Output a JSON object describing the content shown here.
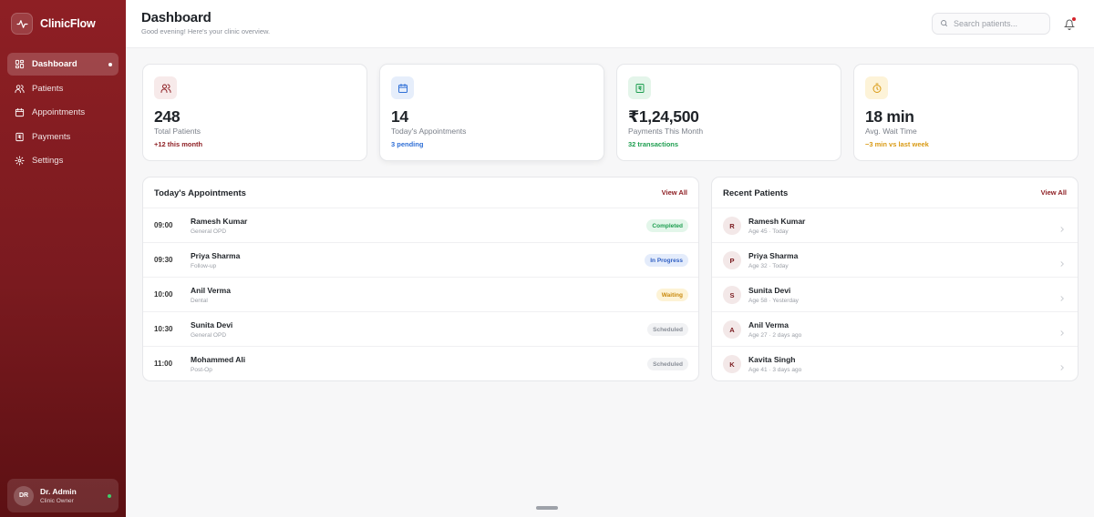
{
  "brand": {
    "name": "ClinicFlow"
  },
  "nav": {
    "items": [
      {
        "label": "Dashboard"
      },
      {
        "label": "Patients"
      },
      {
        "label": "Appointments"
      },
      {
        "label": "Payments"
      },
      {
        "label": "Settings"
      }
    ],
    "active": "Dashboard"
  },
  "user": {
    "initials": "DR",
    "name": "Dr. Admin",
    "role": "Clinic Owner"
  },
  "header": {
    "title": "Dashboard",
    "subtitle": "Good evening! Here's your clinic overview.",
    "search_placeholder": "Search patients..."
  },
  "stats": [
    {
      "value": "248",
      "label": "Total Patients",
      "note": "+12 this month",
      "icon": "users-icon",
      "color": "#8e1f24",
      "bg": "#f7eaea"
    },
    {
      "value": "14",
      "label": "Today's Appointments",
      "note": "3 pending",
      "icon": "calendar-icon",
      "color": "#2f6fd6",
      "bg": "#e6eefb"
    },
    {
      "value": "₹1,24,500",
      "label": "Payments This Month",
      "note": "32 transactions",
      "icon": "receipt-icon",
      "color": "#1e9e50",
      "bg": "#e4f5ea"
    },
    {
      "value": "18 min",
      "label": "Avg. Wait Time",
      "note": "−3 min vs last week",
      "icon": "timer-icon",
      "color": "#d99a14",
      "bg": "#fdf3d8"
    }
  ],
  "appointments": {
    "title": "Today's Appointments",
    "view_all": "View All",
    "rows": [
      {
        "time": "09:00",
        "name": "Ramesh Kumar",
        "type": "General OPD",
        "status": "Completed",
        "status_color": "#1e9e50",
        "status_bg": "#e3f6ea"
      },
      {
        "time": "09:30",
        "name": "Priya Sharma",
        "type": "Follow-up",
        "status": "In Progress",
        "status_color": "#2f5fc4",
        "status_bg": "#e4ecfb"
      },
      {
        "time": "10:00",
        "name": "Anil Verma",
        "type": "Dental",
        "status": "Waiting",
        "status_color": "#c98a0e",
        "status_bg": "#fdf3d6"
      },
      {
        "time": "10:30",
        "name": "Sunita Devi",
        "type": "General OPD",
        "status": "Scheduled",
        "status_color": "#8a8f98",
        "status_bg": "#f1f2f4"
      },
      {
        "time": "11:00",
        "name": "Mohammed Ali",
        "type": "Post-Op",
        "status": "Scheduled",
        "status_color": "#8a8f98",
        "status_bg": "#f1f2f4"
      }
    ]
  },
  "recent_patients": {
    "title": "Recent Patients",
    "view_all": "View All",
    "rows": [
      {
        "initial": "R",
        "name": "Ramesh Kumar",
        "meta": "Age 45 · Today"
      },
      {
        "initial": "P",
        "name": "Priya Sharma",
        "meta": "Age 32 · Today"
      },
      {
        "initial": "S",
        "name": "Sunita Devi",
        "meta": "Age 58 · Yesterday"
      },
      {
        "initial": "A",
        "name": "Anil Verma",
        "meta": "Age 27 · 2 days ago"
      },
      {
        "initial": "K",
        "name": "Kavita Singh",
        "meta": "Age 41 · 3 days ago"
      }
    ]
  }
}
